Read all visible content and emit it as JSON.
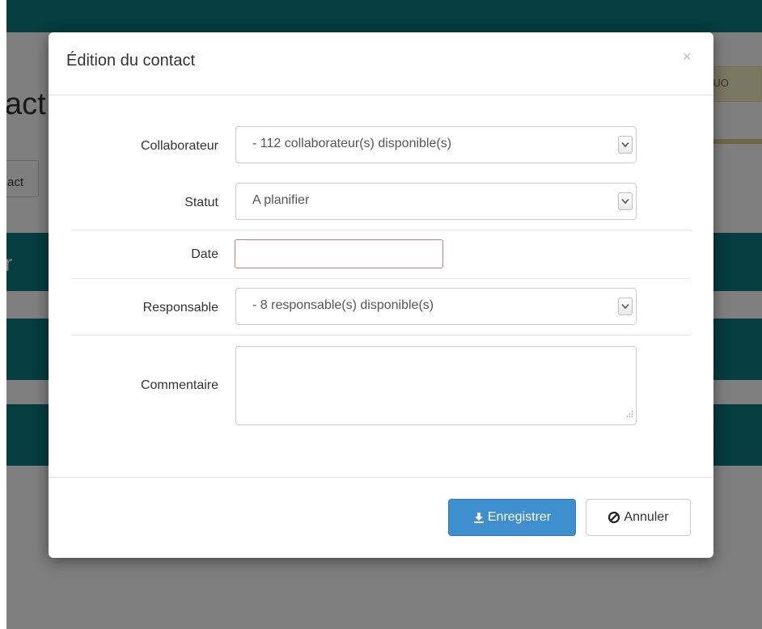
{
  "background": {
    "title_fragment": "act",
    "contact_button_fragment": "act",
    "ribbon_letter": "r",
    "tag_fragment": "rUO"
  },
  "modal": {
    "title": "Édition du contact",
    "close_symbol": "×"
  },
  "form": {
    "collaborateur": {
      "label": "Collaborateur",
      "selected": "- 112 collaborateur(s) disponible(s)"
    },
    "statut": {
      "label": "Statut",
      "selected": "A planifier"
    },
    "date": {
      "label": "Date",
      "value": ""
    },
    "responsable": {
      "label": "Responsable",
      "selected": "- 8 responsable(s) disponible(s)"
    },
    "commentaire": {
      "label": "Commentaire",
      "value": ""
    }
  },
  "footer": {
    "save_label": "Enregistrer",
    "cancel_label": "Annuler"
  },
  "colors": {
    "accent_teal": "#0d7a7f",
    "primary_button": "#3f8fcf",
    "invalid_border": "#c7807d"
  }
}
